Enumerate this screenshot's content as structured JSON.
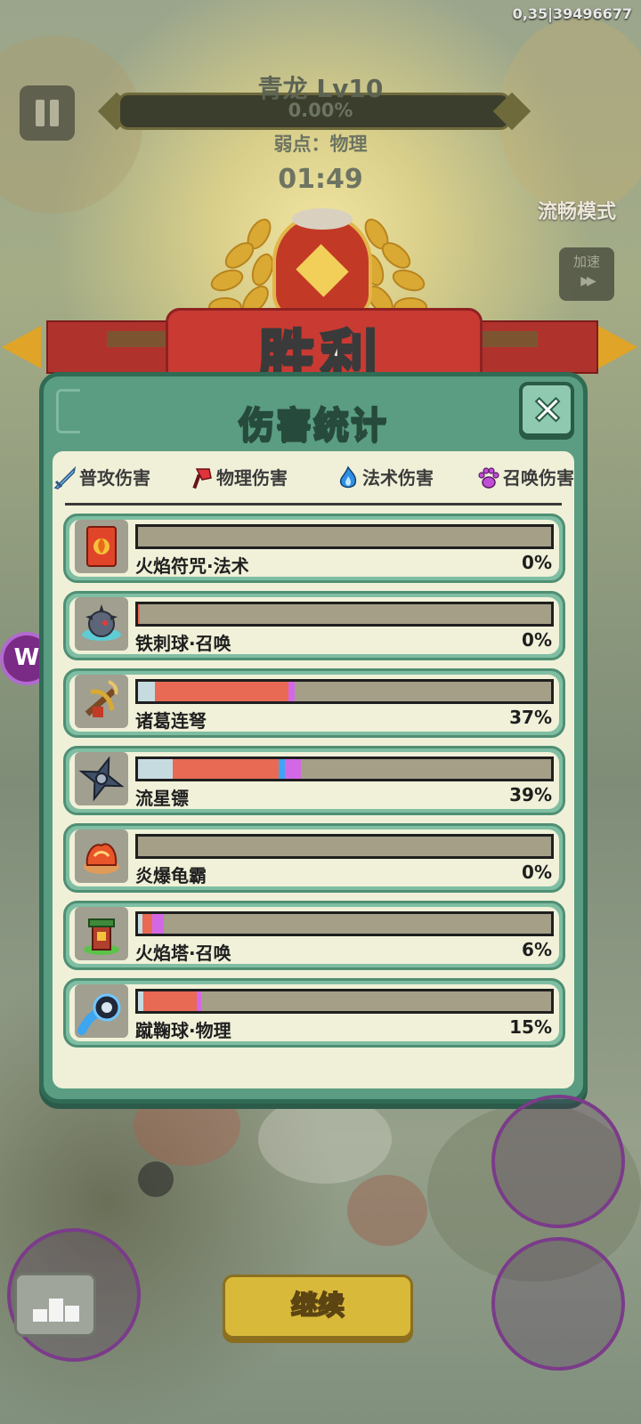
{
  "status": {
    "fps_text": "0,35|39496677"
  },
  "hud": {
    "boss_name": "青龙 Lv10",
    "boss_hp_percent": "0.00%",
    "weakness": "弱点：物理",
    "timer": "01:49",
    "smooth_mode": "流畅模式",
    "speed_label": "加速",
    "speed_arrows": "▶▶"
  },
  "side_badge": "W",
  "victory": {
    "title": "胜利"
  },
  "panel": {
    "title": "伤害统计",
    "close_icon": "×",
    "legend": [
      {
        "label": "普攻伤害",
        "icon": "sword-icon",
        "color": "#c6dbe0"
      },
      {
        "label": "物理伤害",
        "icon": "axe-icon",
        "color": "#e86a55"
      },
      {
        "label": "法术伤害",
        "icon": "flame-icon",
        "color": "#3ea6f0"
      },
      {
        "label": "召唤伤害",
        "icon": "paw-icon",
        "color": "#d368e6"
      }
    ],
    "rows": [
      {
        "name": "火焰符咒·法术",
        "percent": "0%",
        "icon": "fire-talisman-icon",
        "segments": []
      },
      {
        "name": "铁刺球·召唤",
        "percent": "0%",
        "icon": "spike-ball-icon",
        "segments": [
          {
            "type": "physical",
            "share": 0.004
          }
        ]
      },
      {
        "name": "诸葛连弩",
        "percent": "37%",
        "icon": "crossbow-icon",
        "segments": [
          {
            "type": "normal",
            "share": 0.04
          },
          {
            "type": "physical",
            "share": 0.325
          },
          {
            "type": "summon",
            "share": 0.015
          }
        ]
      },
      {
        "name": "流星镖",
        "percent": "39%",
        "icon": "shuriken-icon",
        "segments": [
          {
            "type": "normal",
            "share": 0.085
          },
          {
            "type": "physical",
            "share": 0.255
          },
          {
            "type": "magic",
            "share": 0.015
          },
          {
            "type": "summon",
            "share": 0.04
          }
        ]
      },
      {
        "name": "炎爆龟霸",
        "percent": "0%",
        "icon": "flame-turtle-icon",
        "segments": []
      },
      {
        "name": "火焰塔·召唤",
        "percent": "6%",
        "icon": "fire-tower-icon",
        "segments": [
          {
            "type": "normal",
            "share": 0.01
          },
          {
            "type": "physical",
            "share": 0.025
          },
          {
            "type": "summon",
            "share": 0.028
          }
        ]
      },
      {
        "name": "蹴鞠球·物理",
        "percent": "15%",
        "icon": "kickball-icon",
        "segments": [
          {
            "type": "normal",
            "share": 0.012
          },
          {
            "type": "physical",
            "share": 0.13
          },
          {
            "type": "summon",
            "share": 0.01
          }
        ]
      }
    ]
  },
  "footer": {
    "continue_label": "继续",
    "rank_icon": "podium-icon"
  }
}
